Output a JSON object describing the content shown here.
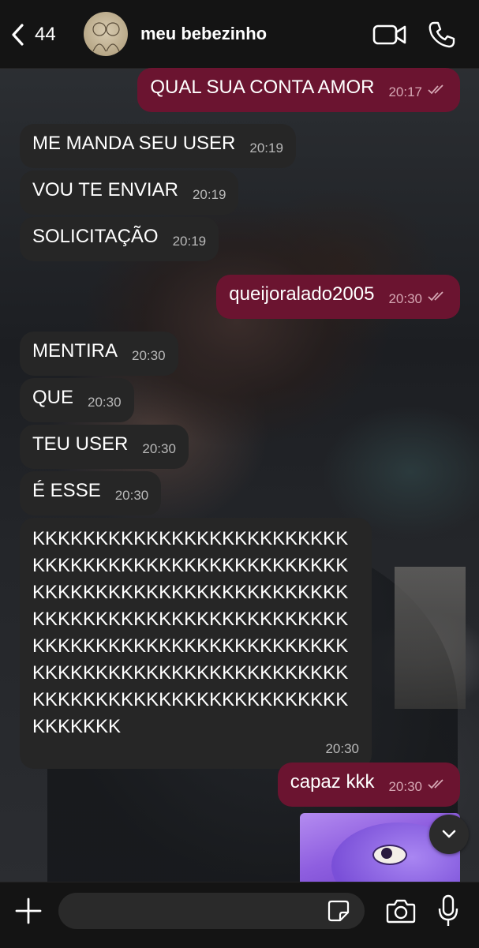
{
  "header": {
    "back_count": "44",
    "contact_name": "meu bebezinho"
  },
  "messages": [
    {
      "dir": "out",
      "text": "QUAL SUA CONTA AMOR",
      "time": "20:17"
    },
    {
      "dir": "in",
      "text": "ME MANDA SEU USER",
      "time": "20:19"
    },
    {
      "dir": "in",
      "text": "VOU TE ENVIAR",
      "time": "20:19"
    },
    {
      "dir": "in",
      "text": "SOLICITAÇÃO",
      "time": "20:19"
    },
    {
      "dir": "out",
      "text": "queijoralado2005",
      "time": "20:30"
    },
    {
      "dir": "in",
      "text": "MENTIRA",
      "time": "20:30"
    },
    {
      "dir": "in",
      "text": "QUE",
      "time": "20:30"
    },
    {
      "dir": "in",
      "text": "TEU USER",
      "time": "20:30"
    },
    {
      "dir": "in",
      "text": "É ESSE",
      "time": "20:30"
    },
    {
      "dir": "in",
      "text": "KKKKKKKKKKKKKKKKKKKKKKKKKKKKKKKKKKKKKKKKKKKKKKKKKKKKKKKKKKKKKKKKKKKKKKKKKKKKKKKKKKKKKKKKKKKKKKKKKKKKKKKKKKKKKKKKKKKKKKKKKKKKKKKKKKKKKKKKKKKKKKKKKKKKKKKKKKKKKKKKKKKKKKKKKKKKKKKKKKKKKK",
      "time": "20:30"
    },
    {
      "dir": "out",
      "text": "capaz kkk",
      "time": "20:30"
    }
  ],
  "composer": {
    "placeholder": ""
  },
  "colors": {
    "outgoing_bubble": "#6b1430",
    "incoming_bubble": "#262626",
    "header_bg": "#141414"
  },
  "icons": [
    "back-chevron-icon",
    "video-call-icon",
    "phone-icon",
    "plus-icon",
    "sticker-icon",
    "camera-icon",
    "microphone-icon",
    "chevron-down-icon"
  ]
}
